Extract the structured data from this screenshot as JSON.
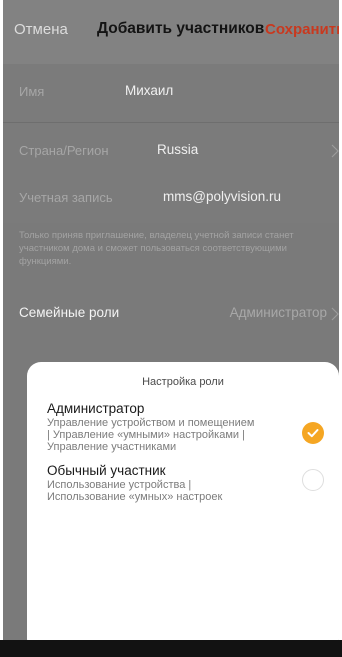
{
  "header": {
    "cancel_label": "Отмена",
    "title": "Добавить участников",
    "save_label": "Сохранить",
    "save_color": "#c8391f"
  },
  "form": {
    "name": {
      "label": "Имя",
      "value": "Михаил"
    },
    "country": {
      "label": "Страна/Регион",
      "value": "Russia"
    },
    "account": {
      "label": "Учетная запись",
      "value": "mms@polyvision.ru"
    },
    "hint": "Только приняв приглашение, владелец учетной записи станет участником дома и сможет пользоваться соответствующими функциями.",
    "family_role": {
      "label": "Семейные роли",
      "value": "Администратор"
    }
  },
  "role_sheet": {
    "title": "Настройка роли",
    "options": [
      {
        "title": "Администратор",
        "description_lines": [
          "Управление устройством и помещением",
          "| Управление «умными» настройками |",
          "Управление участниками"
        ],
        "selected": true
      },
      {
        "title": "Обычный участник",
        "description_lines": [
          "Использование устройства |",
          "Использование «умных» настроек"
        ],
        "selected": false
      }
    ],
    "accent_color": "#f5a623"
  },
  "icons": {
    "chevron": "chevron-right-icon",
    "check": "check-icon"
  }
}
